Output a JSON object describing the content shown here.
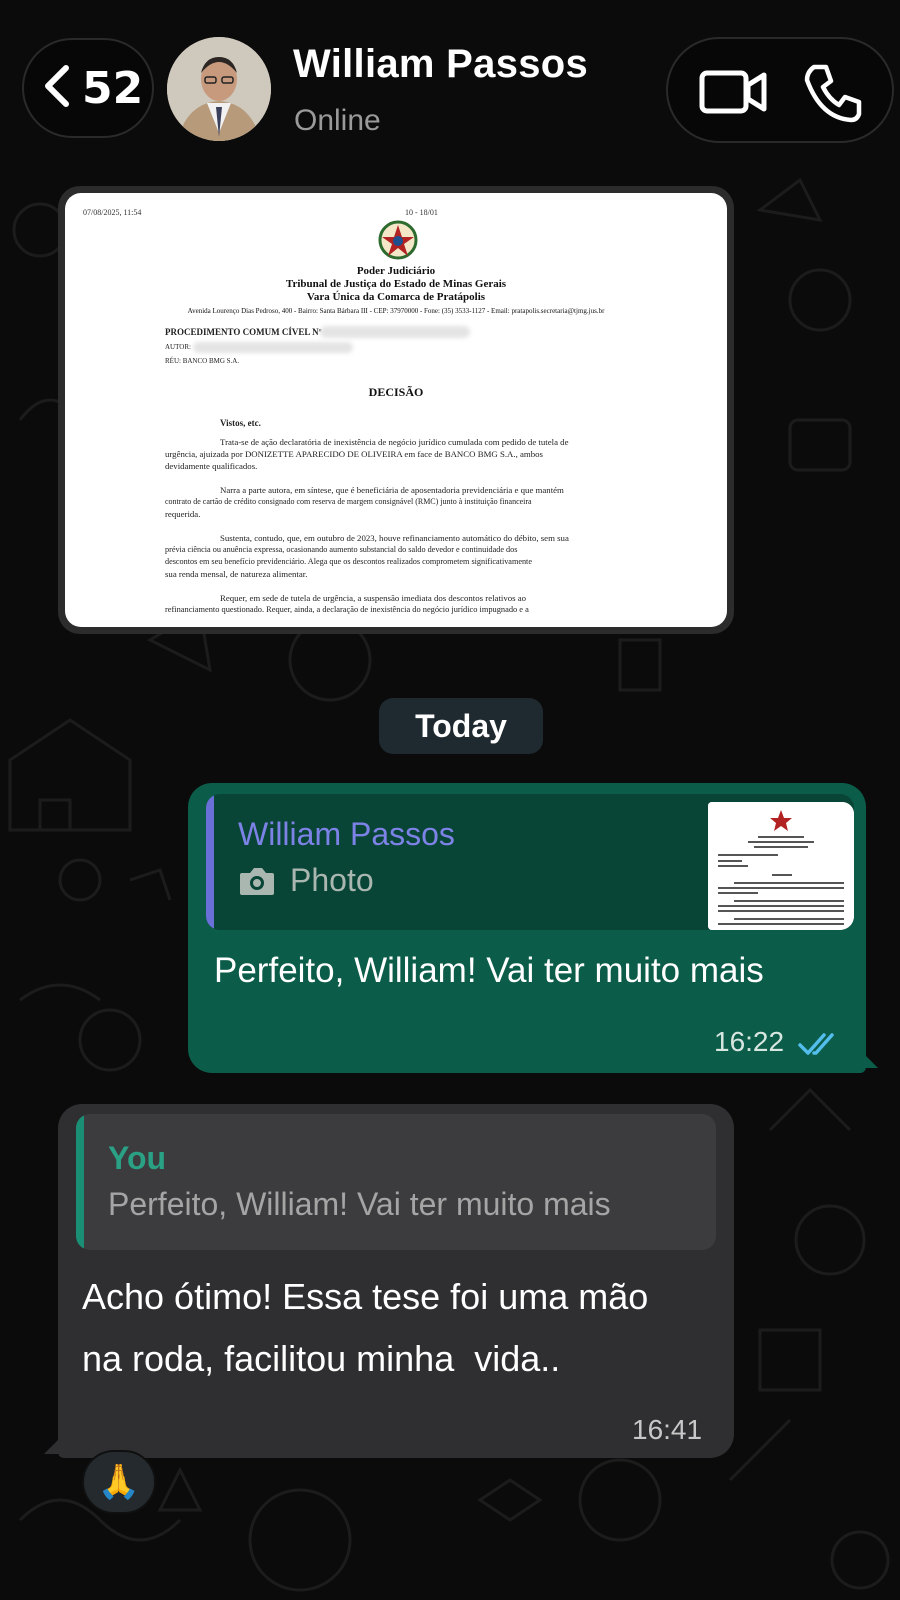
{
  "header": {
    "back_count": "52",
    "contact_name": "William Passos",
    "contact_status": "Online"
  },
  "document": {
    "date_left": "07/08/2025, 11:54",
    "page": "10 - 18/01",
    "org1": "Poder Judiciário",
    "org2": "Tribunal de Justiça do Estado de Minas Gerais",
    "org3": "Vara Única da Comarca de Pratápolis",
    "address": "Avenida Lourenço Dias Pedroso, 400 - Bairro: Santa Bárbara III - CEP: 37970000 - Fone: (35) 3533-1127 - Email: pratapolis.secretaria@tjmg.jus.br",
    "proc": "PROCEDIMENTO COMUM CÍVEL Nº",
    "autor": "AUTOR:",
    "reu": "RÉU: BANCO BMG S.A.",
    "title": "DECISÃO",
    "vistos": "Vistos, etc.",
    "p1a": "Trata-se de ação declaratória de inexistência de negócio jurídico cumulada com pedido de tutela de",
    "p1b": "urgência, ajuizada por DONIZETTE APARECIDO DE OLIVEIRA em face de BANCO BMG S.A., ambos",
    "p1c": "devidamente qualificados.",
    "p2a": "Narra a parte autora, em síntese, que é beneficiária de aposentadoria previdenciária e que mantém",
    "p2b": "contrato de cartão de crédito consignado com reserva de margem consignável (RMC) junto à instituição financeira",
    "p2c": "requerida.",
    "p3a": "Sustenta, contudo, que, em outubro de 2023, houve refinanciamento automático do débito, sem sua",
    "p3b": "prévia ciência ou anuência expressa, ocasionando aumento substancial do saldo devedor e continuidade dos",
    "p3c": "descontos em seu benefício previdenciário. Alega que os descontos realizados comprometem significativamente",
    "p3d": "sua renda mensal, de natureza alimentar.",
    "p4a": "Requer, em sede de tutela de urgência, a suspensão imediata dos descontos relativos ao",
    "p4b": "refinanciamento questionado. Requer, ainda, a declaração de inexistência do negócio jurídico impugnado e a"
  },
  "date_chip": "Today",
  "outgoing": {
    "quote_name": "William Passos",
    "quote_type": "Photo",
    "text": "Perfeito, William! Vai ter muito mais",
    "time": "16:22"
  },
  "incoming": {
    "quote_name": "You",
    "quote_text": "Perfeito, William! Vai ter muito mais",
    "text": "Acho ótimo! Essa tese foi uma mão\nna roda, facilitou minha  vida..",
    "time": "16:41",
    "reaction": "🙏"
  },
  "icons": {
    "back": "chevron-left-icon",
    "video": "video-camera-icon",
    "phone": "phone-icon",
    "camera": "camera-icon",
    "read": "double-check-icon"
  },
  "colors": {
    "outgoing_bubble": "#0b5c49",
    "incoming_bubble": "#2f2f31",
    "quote_bar_out": "#6b6fd8",
    "quote_bar_in": "#1a8f75",
    "read_ticks": "#53bdeb"
  }
}
